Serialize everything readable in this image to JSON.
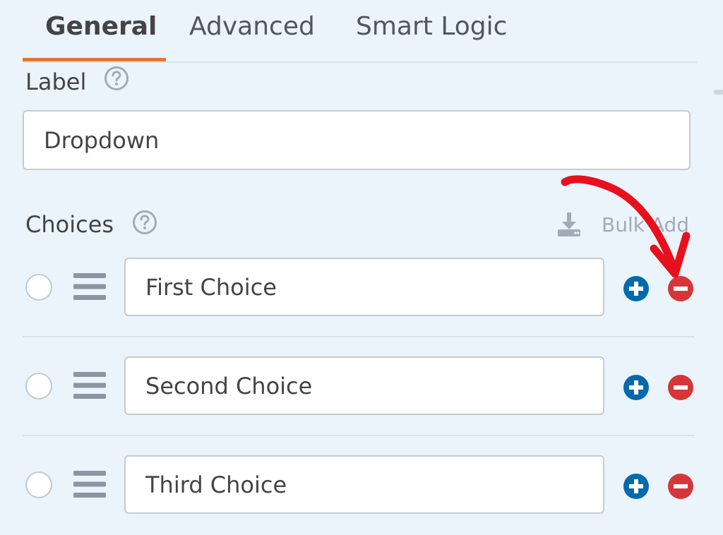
{
  "tabs": [
    {
      "label": "General",
      "active": true
    },
    {
      "label": "Advanced",
      "active": false
    },
    {
      "label": "Smart Logic",
      "active": false
    }
  ],
  "label_field": {
    "label": "Label",
    "value": "Dropdown",
    "help_icon": "question-circle-icon"
  },
  "choices": {
    "label": "Choices",
    "help_icon": "question-circle-icon",
    "bulk_add_label": "Bulk Add",
    "bulk_add_icon": "download-icon",
    "items": [
      {
        "value": "First Choice"
      },
      {
        "value": "Second Choice"
      },
      {
        "value": "Third Choice"
      }
    ],
    "add_icon": "plus-circle-icon",
    "remove_icon": "minus-circle-icon"
  },
  "colors": {
    "background": "#ebf3fb",
    "active_tab_accent": "#e27730",
    "add_button": "#036aab",
    "remove_button": "#d63638",
    "annotation_arrow": "#e8101c"
  }
}
